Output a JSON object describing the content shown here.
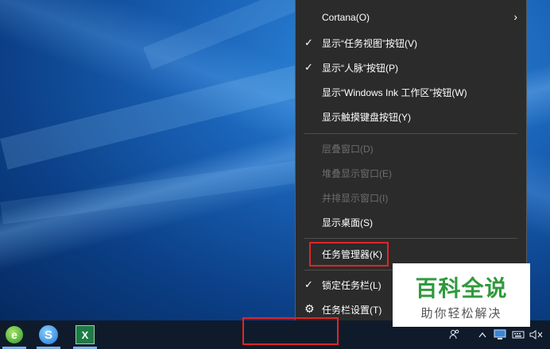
{
  "menu": {
    "items": [
      {
        "label": "Cortana(O)",
        "checked": false,
        "disabled": false,
        "submenu": true
      },
      {
        "label": "显示“任务视图”按钮(V)",
        "checked": true,
        "disabled": false
      },
      {
        "label": "显示“人脉”按钮(P)",
        "checked": true,
        "disabled": false
      },
      {
        "label": "显示“Windows Ink 工作区”按钮(W)",
        "checked": false,
        "disabled": false
      },
      {
        "label": "显示触摸键盘按钮(Y)",
        "checked": false,
        "disabled": false
      },
      {
        "label": "层叠窗口(D)",
        "checked": false,
        "disabled": true
      },
      {
        "label": "堆叠显示窗口(E)",
        "checked": false,
        "disabled": true
      },
      {
        "label": "并排显示窗口(I)",
        "checked": false,
        "disabled": true
      },
      {
        "label": "显示桌面(S)",
        "checked": false,
        "disabled": false
      },
      {
        "label": "任务管理器(K)",
        "checked": false,
        "disabled": false,
        "highlighted": true
      },
      {
        "label": "锁定任务栏(L)",
        "checked": true,
        "disabled": false
      },
      {
        "label": "任务栏设置(T)",
        "checked": false,
        "disabled": false,
        "icon": "gear-icon"
      }
    ]
  },
  "taskbar": {
    "apps": [
      {
        "name": "ie-icon",
        "glyph": "e"
      },
      {
        "name": "sogou-browser-icon",
        "glyph": "S"
      },
      {
        "name": "excel-icon",
        "glyph": "X"
      }
    ],
    "tray": [
      "people-icon",
      "chevron-up-icon",
      "network-icon",
      "keyboard-icon",
      "volume-muted-icon"
    ]
  },
  "watermark": {
    "title": "百科全说",
    "subtitle": "助你轻松解决"
  },
  "colors": {
    "menu_bg": "#2b2b2b",
    "highlight_red": "#e02626",
    "watermark_green": "#2f9a3b"
  }
}
